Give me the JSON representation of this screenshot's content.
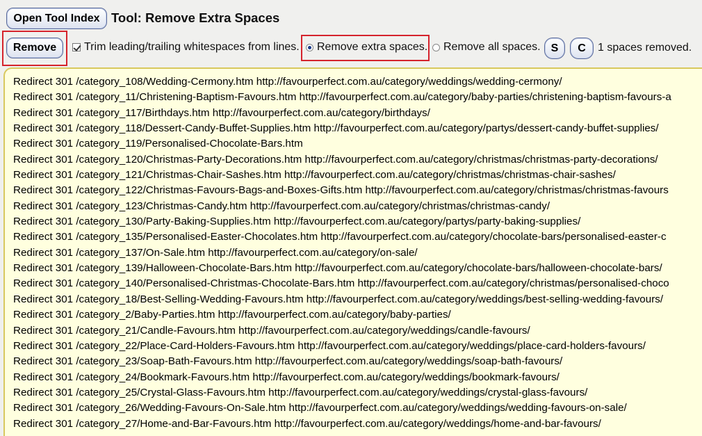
{
  "header": {
    "open_index_label": "Open Tool Index",
    "title": "Tool: Remove Extra Spaces"
  },
  "toolbar": {
    "remove_label": "Remove",
    "trim_label": "Trim leading/trailing whitespaces from lines.",
    "trim_checked": true,
    "remove_extra_label": "Remove extra spaces.",
    "remove_extra_selected": true,
    "remove_all_label": "Remove all spaces.",
    "s_label": "S",
    "c_label": "C",
    "status": "1 spaces removed."
  },
  "colors": {
    "highlight_box": "#d5232c",
    "textarea_bg": "#ffffdf",
    "textarea_border": "#d8c85e"
  },
  "editor": {
    "lines": [
      "Redirect 301 /category_108/Wedding-Cermony.htm http://favourperfect.com.au/category/weddings/wedding-cermony/",
      "Redirect 301 /category_11/Christening-Baptism-Favours.htm http://favourperfect.com.au/category/baby-parties/christening-baptism-favours-a",
      "Redirect 301 /category_117/Birthdays.htm http://favourperfect.com.au/category/birthdays/",
      "Redirect 301 /category_118/Dessert-Candy-Buffet-Supplies.htm http://favourperfect.com.au/category/partys/dessert-candy-buffet-supplies/",
      "Redirect 301 /category_119/Personalised-Chocolate-Bars.htm",
      "Redirect 301 /category_120/Christmas-Party-Decorations.htm http://favourperfect.com.au/category/christmas/christmas-party-decorations/",
      "Redirect 301 /category_121/Christmas-Chair-Sashes.htm http://favourperfect.com.au/category/christmas/christmas-chair-sashes/",
      "Redirect 301 /category_122/Christmas-Favours-Bags-and-Boxes-Gifts.htm http://favourperfect.com.au/category/christmas/christmas-favours",
      "Redirect 301 /category_123/Christmas-Candy.htm http://favourperfect.com.au/category/christmas/christmas-candy/",
      "Redirect 301 /category_130/Party-Baking-Supplies.htm http://favourperfect.com.au/category/partys/party-baking-supplies/",
      "Redirect 301 /category_135/Personalised-Easter-Chocolates.htm http://favourperfect.com.au/category/chocolate-bars/personalised-easter-c",
      "Redirect 301 /category_137/On-Sale.htm http://favourperfect.com.au/category/on-sale/",
      "Redirect 301 /category_139/Halloween-Chocolate-Bars.htm http://favourperfect.com.au/category/chocolate-bars/halloween-chocolate-bars/",
      "Redirect 301 /category_140/Personalised-Christmas-Chocolate-Bars.htm http://favourperfect.com.au/category/christmas/personalised-choco",
      "Redirect 301 /category_18/Best-Selling-Wedding-Favours.htm http://favourperfect.com.au/category/weddings/best-selling-wedding-favours/",
      "Redirect 301 /category_2/Baby-Parties.htm http://favourperfect.com.au/category/baby-parties/",
      "Redirect 301 /category_21/Candle-Favours.htm http://favourperfect.com.au/category/weddings/candle-favours/",
      "Redirect 301 /category_22/Place-Card-Holders-Favours.htm http://favourperfect.com.au/category/weddings/place-card-holders-favours/",
      "Redirect 301 /category_23/Soap-Bath-Favours.htm http://favourperfect.com.au/category/weddings/soap-bath-favours/",
      "Redirect 301 /category_24/Bookmark-Favours.htm http://favourperfect.com.au/category/weddings/bookmark-favours/",
      "Redirect 301 /category_25/Crystal-Glass-Favours.htm http://favourperfect.com.au/category/weddings/crystal-glass-favours/",
      "Redirect 301 /category_26/Wedding-Favours-On-Sale.htm http://favourperfect.com.au/category/weddings/wedding-favours-on-sale/",
      "Redirect 301 /category_27/Home-and-Bar-Favours.htm http://favourperfect.com.au/category/weddings/home-and-bar-favours/"
    ]
  }
}
